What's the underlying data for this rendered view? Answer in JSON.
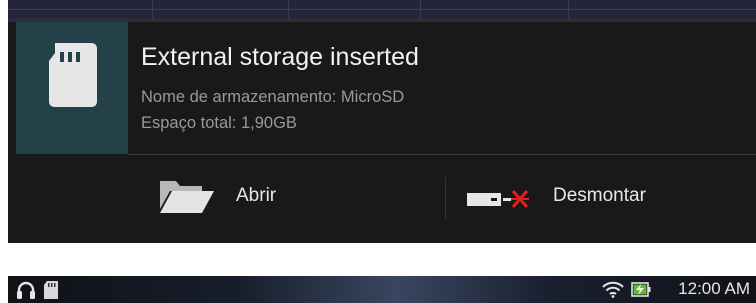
{
  "notification": {
    "title": "External storage inserted",
    "storage_name": "Nome de armazenamento: MicroSD",
    "total_space": "Espaço total: 1,90GB",
    "icon": "sd-card-icon",
    "accent_color": "#244048"
  },
  "actions": {
    "open": {
      "label": "Abrir",
      "icon": "folder-open-icon"
    },
    "unmount": {
      "label": "Desmontar",
      "icon": "unmount-icon"
    }
  },
  "status_bar": {
    "time": "12:00 AM",
    "left_icons": [
      "headset-icon",
      "sd-card-icon"
    ],
    "right_icons": [
      "wifi-icon",
      "battery-charging-icon"
    ]
  }
}
